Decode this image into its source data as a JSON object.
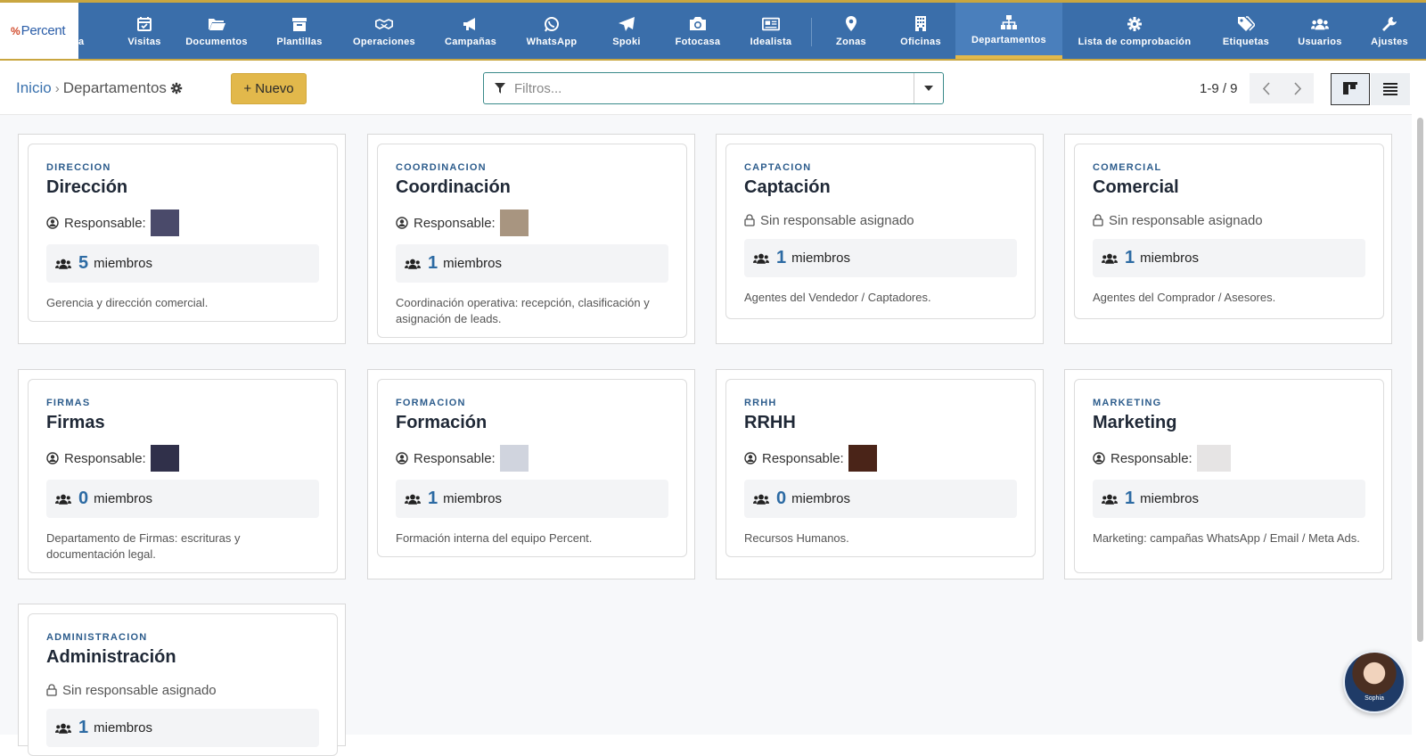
{
  "brand": {
    "name": "Percent"
  },
  "nav": {
    "partial_label": "a",
    "items": [
      {
        "label": "Visitas",
        "icon": "calendar-check-icon"
      },
      {
        "label": "Documentos",
        "icon": "folder-open-icon"
      },
      {
        "label": "Plantillas",
        "icon": "archive-icon"
      },
      {
        "label": "Operaciones",
        "icon": "handshake-icon"
      },
      {
        "label": "Campañas",
        "icon": "megaphone-icon"
      },
      {
        "label": "WhatsApp",
        "icon": "whatsapp-icon"
      },
      {
        "label": "Spoki",
        "icon": "paper-plane-icon"
      },
      {
        "label": "Fotocasa",
        "icon": "camera-icon"
      },
      {
        "label": "Idealista",
        "icon": "newspaper-icon"
      },
      {
        "label": "Zonas",
        "icon": "map-marker-icon"
      },
      {
        "label": "Oficinas",
        "icon": "building-icon"
      },
      {
        "label": "Departamentos",
        "icon": "sitemap-icon",
        "active": true
      },
      {
        "label": "Lista de comprobación",
        "icon": "gear-icon"
      },
      {
        "label": "Etiquetas",
        "icon": "tags-icon"
      },
      {
        "label": "Usuarios",
        "icon": "users-icon"
      },
      {
        "label": "Ajustes",
        "icon": "wrench-icon"
      }
    ]
  },
  "toolbar": {
    "breadcrumb_home": "Inicio",
    "breadcrumb_sep": "›",
    "breadcrumb_current": "Departamentos",
    "new_button": "+ Nuevo",
    "search_placeholder": "Filtros...",
    "pager_text": "1-9 / 9"
  },
  "labels": {
    "responsable": "Responsable:",
    "no_responsable": "Sin responsable asignado",
    "members": "miembros"
  },
  "departments": [
    {
      "code": "DIRECCION",
      "name": "Dirección",
      "has_responsable": true,
      "swatch": "#4a4a6a",
      "members": "5",
      "description": "Gerencia y dirección comercial."
    },
    {
      "code": "COORDINACION",
      "name": "Coordinación",
      "has_responsable": true,
      "swatch": "#a89580",
      "members": "1",
      "description": "Coordinación operativa: recepción, clasificación y asignación de leads."
    },
    {
      "code": "CAPTACION",
      "name": "Captación",
      "has_responsable": false,
      "members": "1",
      "description": "Agentes del Vendedor / Captadores."
    },
    {
      "code": "COMERCIAL",
      "name": "Comercial",
      "has_responsable": false,
      "members": "1",
      "description": "Agentes del Comprador / Asesores."
    },
    {
      "code": "FIRMAS",
      "name": "Firmas",
      "has_responsable": true,
      "swatch": "#30304a",
      "members": "0",
      "description": "Departamento de Firmas: escrituras y documentación legal."
    },
    {
      "code": "FORMACION",
      "name": "Formación",
      "has_responsable": true,
      "swatch": "#d0d4de",
      "members": "1",
      "description": "Formación interna del equipo Percent."
    },
    {
      "code": "RRHH",
      "name": "RRHH",
      "has_responsable": true,
      "swatch": "#4a2418",
      "members": "0",
      "description": "Recursos Humanos."
    },
    {
      "code": "MARKETING",
      "name": "Marketing",
      "has_responsable": true,
      "swatch": "#e6e4e4",
      "members": "1",
      "description": "Marketing: campañas WhatsApp / Email / Meta Ads."
    },
    {
      "code": "ADMINISTRACION",
      "name": "Administración",
      "has_responsable": false,
      "members": "1",
      "description": ""
    }
  ],
  "assistant": {
    "label": "Sophia"
  },
  "colors": {
    "nav_bg": "#3a6eaa",
    "accent": "#e2b84b",
    "link": "#3a72ae"
  }
}
